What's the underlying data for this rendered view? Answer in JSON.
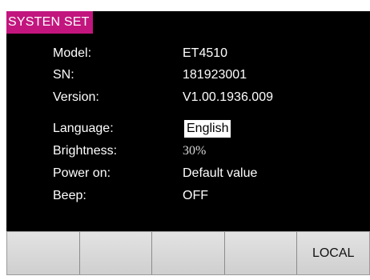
{
  "screen": {
    "title_tab": "SYSTEN SET"
  },
  "info": [
    {
      "label": "Model:",
      "value": "ET4510"
    },
    {
      "label": "SN:",
      "value": "181923001"
    },
    {
      "label": "Version:",
      "value": "V1.00.1936.009"
    }
  ],
  "settings": [
    {
      "label": "Language:",
      "value": "English",
      "selected": true
    },
    {
      "label": "Brightness:",
      "value": "30%"
    },
    {
      "label": "Power on:",
      "value": "Default value"
    },
    {
      "label": "Beep:",
      "value": "OFF"
    }
  ],
  "softkeys": [
    "",
    "",
    "",
    "",
    "LOCAL"
  ],
  "colors": {
    "title_bg": "#c2167e",
    "display_bg": "#000000",
    "text": "#ffffff",
    "softkey_bg": "#d9d9d9"
  }
}
